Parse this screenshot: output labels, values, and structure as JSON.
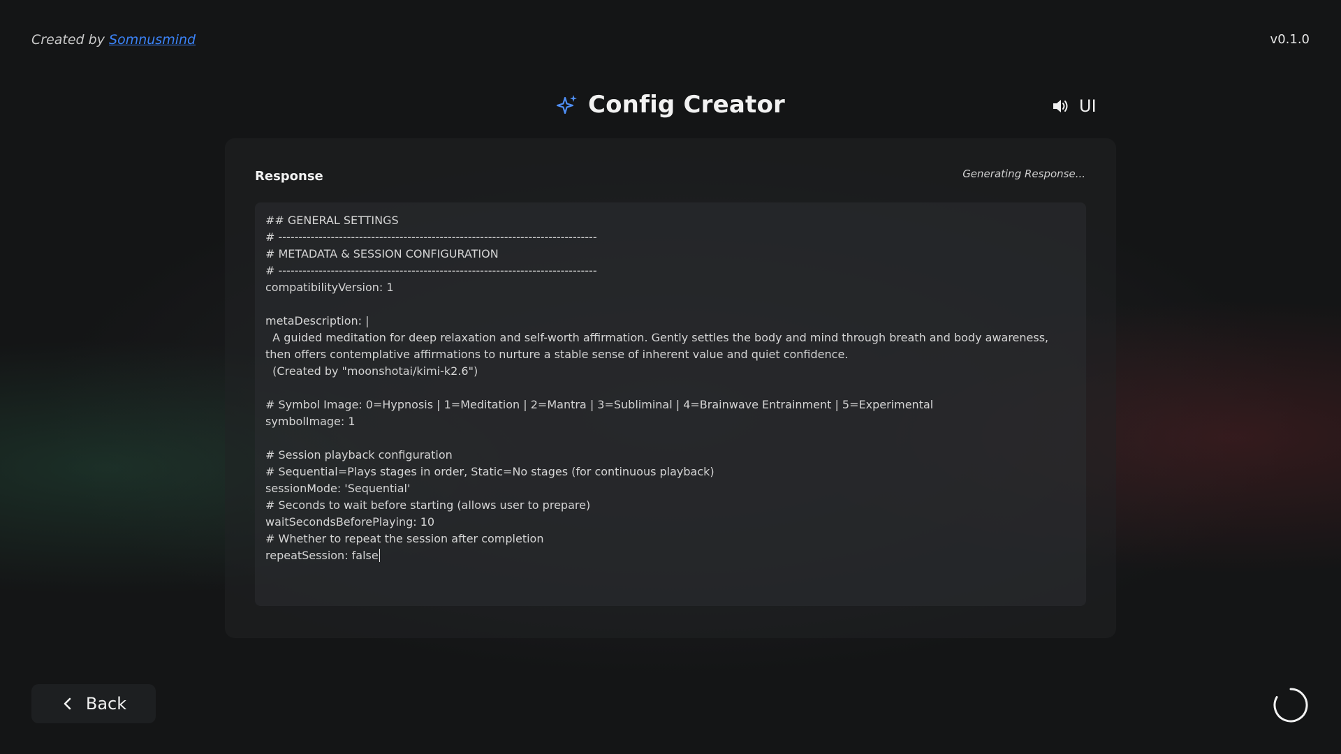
{
  "header": {
    "credit_prefix": "Created by",
    "credit_author": "Somnusmind",
    "version": "v0.1.0",
    "title": "Config Creator",
    "title_icon": "sparkle-icon",
    "sound_icon": "speaker-icon",
    "sound_label": "UI"
  },
  "response": {
    "heading": "Response",
    "status": "Generating Response...",
    "content": "## GENERAL SETTINGS\n# -------------------------------------------------------------------------------\n# METADATA & SESSION CONFIGURATION\n# -------------------------------------------------------------------------------\ncompatibilityVersion: 1\n\nmetaDescription: |\n  A guided meditation for deep relaxation and self-worth affirmation. Gently settles the body and mind through breath and body awareness, then offers contemplative affirmations to nurture a stable sense of inherent value and quiet confidence.\n  (Created by \"moonshotai/kimi-k2.6\")\n\n# Symbol Image: 0=Hypnosis | 1=Meditation | 2=Mantra | 3=Subliminal | 4=Brainwave Entrainment | 5=Experimental\nsymbolImage: 1\n\n# Session playback configuration\n# Sequential=Plays stages in order, Static=No stages (for continuous playback)\nsessionMode: 'Sequential'\n# Seconds to wait before starting (allows user to prepare)\nwaitSecondsBeforePlaying: 10\n# Whether to repeat the session after completion\nrepeatSession: false"
  },
  "footer": {
    "back_label": "Back",
    "back_icon": "chevron-left-icon",
    "spinner_icon": "loading-spinner-icon"
  },
  "colors": {
    "accent": "#3b82f6",
    "background": "#141516"
  }
}
